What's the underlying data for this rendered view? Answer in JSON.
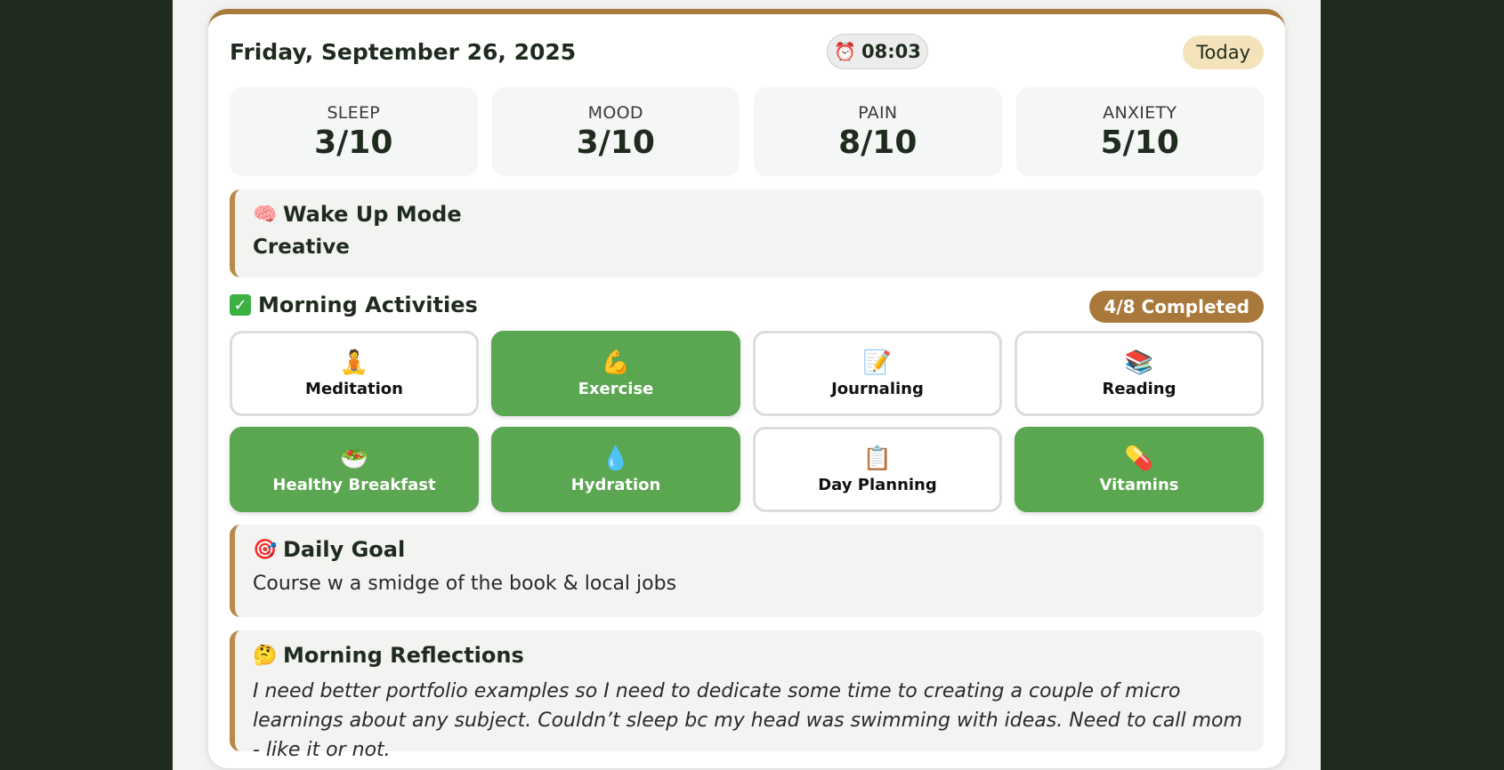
{
  "header": {
    "date": "Friday, September 26, 2025",
    "time_icon": "alarm-clock-icon",
    "time": "08:03",
    "today_label": "Today"
  },
  "metrics": [
    {
      "label": "SLEEP",
      "value": "3/10"
    },
    {
      "label": "MOOD",
      "value": "3/10"
    },
    {
      "label": "PAIN",
      "value": "8/10"
    },
    {
      "label": "ANXIETY",
      "value": "5/10"
    }
  ],
  "wake_up": {
    "icon": "brain-icon",
    "title": "Wake Up Mode",
    "value": "Creative"
  },
  "activities": {
    "icon": "check-box-icon",
    "title": "Morning Activities",
    "completed_label": "4/8 Completed",
    "items": [
      {
        "icon": "meditation-icon",
        "label": "Meditation",
        "done": false
      },
      {
        "icon": "flexed-arm-icon",
        "label": "Exercise",
        "done": true
      },
      {
        "icon": "memo-icon",
        "label": "Journaling",
        "done": false
      },
      {
        "icon": "books-icon",
        "label": "Reading",
        "done": false
      },
      {
        "icon": "salad-icon",
        "label": "Healthy Breakfast",
        "done": true
      },
      {
        "icon": "droplet-icon",
        "label": "Hydration",
        "done": true
      },
      {
        "icon": "clipboard-icon",
        "label": "Day Planning",
        "done": false
      },
      {
        "icon": "pill-icon",
        "label": "Vitamins",
        "done": true
      }
    ]
  },
  "daily_goal": {
    "icon": "target-icon",
    "title": "Daily Goal",
    "text": "Course w a smidge of the book & local jobs"
  },
  "reflections": {
    "icon": "thinking-face-icon",
    "title": "Morning Reflections",
    "text": "I need better portfolio examples so I need to dedicate some time to creating a couple of micro learnings about any subject. Couldn’t sleep bc my head was swimming with ideas. Need to call mom - like it or not."
  },
  "colors": {
    "accent": "#a8793a",
    "done_green": "#5ba651",
    "background": "#1f2b1f"
  }
}
